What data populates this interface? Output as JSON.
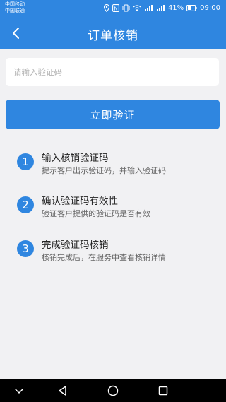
{
  "status_bar": {
    "carrier_1": "中国移动",
    "carrier_2": "中国联通",
    "battery": "41%",
    "time": "09:00"
  },
  "header": {
    "title": "订单核销",
    "back_icon": "chevron-left-icon"
  },
  "input": {
    "placeholder": "请输入验证码",
    "value": ""
  },
  "verify_button": {
    "label": "立即验证"
  },
  "steps": [
    {
      "number": "1",
      "title": "输入核销验证码",
      "description": "提示客户出示验证码，并输入验证码"
    },
    {
      "number": "2",
      "title": "确认验证码有效性",
      "description": "验证客户提供的验证码是否有效"
    },
    {
      "number": "3",
      "title": "完成验证码核销",
      "description": "核销完成后，在服务中查看核销详情"
    }
  ],
  "nav_bar": {
    "icons": [
      "chevron-down-icon",
      "back-triangle-icon",
      "home-circle-icon",
      "recents-square-icon"
    ]
  },
  "colors": {
    "primary": "#2f86e0",
    "background": "#f1f1f3",
    "nav_background": "#000000"
  }
}
